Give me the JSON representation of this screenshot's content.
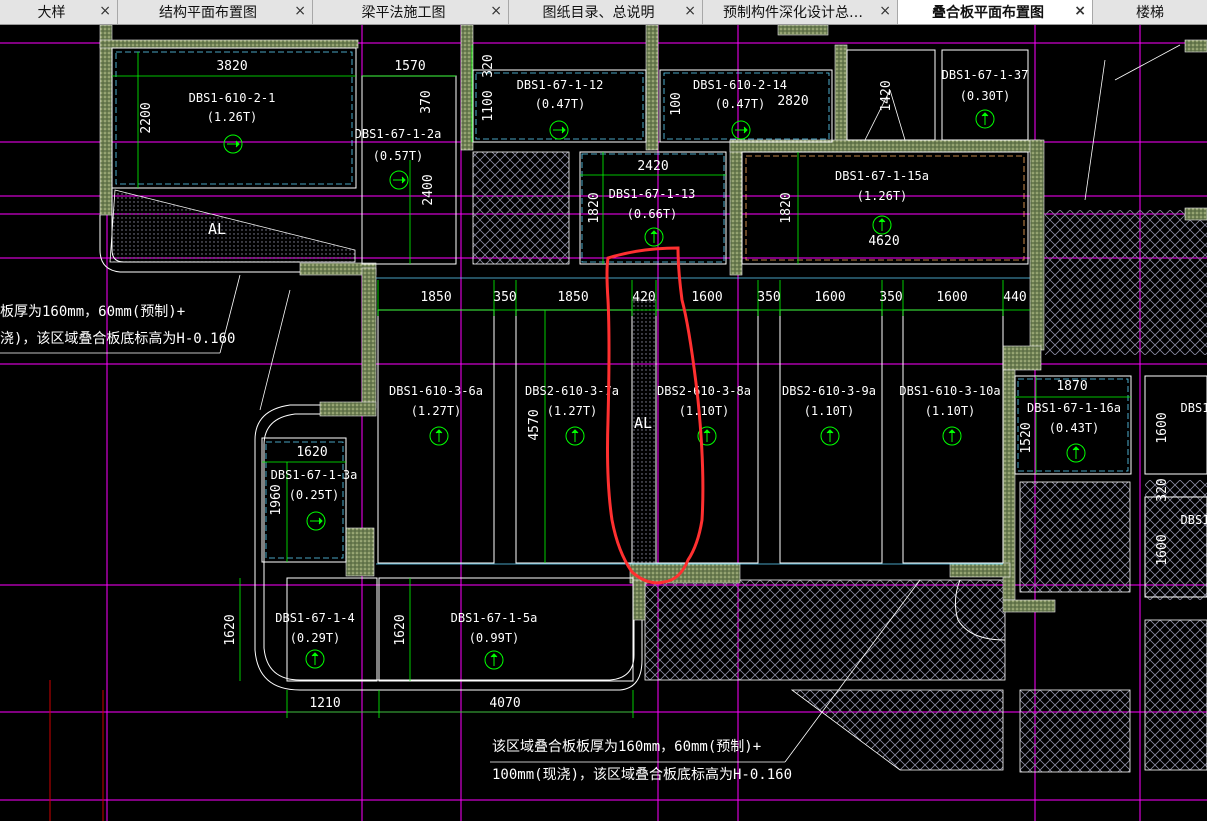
{
  "tabs": [
    {
      "label": "大样",
      "active": false
    },
    {
      "label": "结构平面布置图",
      "active": false
    },
    {
      "label": "梁平法施工图",
      "active": false
    },
    {
      "label": "图纸目录、总说明",
      "active": false
    },
    {
      "label": "预制构件深化设计总…",
      "active": false
    },
    {
      "label": "叠合板平面布置图",
      "active": true
    },
    {
      "label": "楼梯",
      "active": false
    }
  ],
  "close_glyph": "×",
  "colors": {
    "background": "#000000",
    "wall": "#6d7f52",
    "panel_outline": "#ffffff",
    "dimension": "#00ff00",
    "label": "#ffffff",
    "grid_magenta": "#ff00ff",
    "annotation_highlight": "#ff3030",
    "hatch": "#8a8aa0"
  },
  "dimensions": {
    "d3820": "3820",
    "d1570": "1570",
    "d320": "320",
    "d370": "370",
    "d1100": "1100",
    "d100": "100",
    "d2820": "2820",
    "d1420": "1420",
    "d2200": "2200",
    "d2400": "2400",
    "d2420": "2420",
    "d1820a": "1820",
    "d1820b": "1820",
    "d4620": "4620",
    "d1850a": "1850",
    "d350a": "350",
    "d1850b": "1850",
    "d420": "420",
    "d1600a": "1600",
    "d350b": "350",
    "d1600b": "1600",
    "d350c": "350",
    "d1600c": "1600",
    "d440": "440",
    "d1870": "1870",
    "d4570": "4570",
    "d1520": "1520",
    "d1600r1": "1600",
    "d320r": "320",
    "d1600r2": "1600",
    "d1620": "1620",
    "d1960": "1960",
    "d1620b": "1620",
    "d1620c": "1620",
    "d1210": "1210",
    "d4070": "4070"
  },
  "panels": [
    {
      "id": "DBS1-610-2-1",
      "weight": "(1.26T)"
    },
    {
      "id": "DBS1-67-1-2a",
      "weight": "(0.57T)"
    },
    {
      "id": "DBS1-67-1-12",
      "weight": "(0.47T)"
    },
    {
      "id": "DBS1-610-2-14",
      "weight": "(0.47T)"
    },
    {
      "id": "DBS1-67-1-37",
      "weight": "(0.30T)"
    },
    {
      "id": "DBS1-67-1-13",
      "weight": "(0.66T)"
    },
    {
      "id": "DBS1-67-1-15a",
      "weight": "(1.26T)"
    },
    {
      "id": "DBS1-610-3-6a",
      "weight": "(1.27T)"
    },
    {
      "id": "DBS2-610-3-7a",
      "weight": "(1.27T)"
    },
    {
      "id": "DBS2-610-3-8a",
      "weight": "(1.10T)"
    },
    {
      "id": "DBS2-610-3-9a",
      "weight": "(1.10T)"
    },
    {
      "id": "DBS1-610-3-10a",
      "weight": "(1.10T)"
    },
    {
      "id": "DBS1-67-1-16a",
      "weight": "(0.43T)"
    },
    {
      "id": "DBS1-67-1-3a",
      "weight": "(0.25T)"
    },
    {
      "id": "DBS1-67-1-4",
      "weight": "(0.29T)"
    },
    {
      "id": "DBS1-67-1-5a",
      "weight": "(0.99T)"
    }
  ],
  "edge_labels": {
    "dbs1_right_1": "DBS1",
    "dbs1_right_2": "DBS1"
  },
  "al_labels": {
    "al1": "AL",
    "al2": "AL"
  },
  "notes": {
    "left_line1": "板厚为160mm，60mm(预制)+",
    "left_line2": "浇)，该区域叠合板底标高为H-0.160",
    "bottom_line1": "该区域叠合板板厚为160mm，60mm(预制)+",
    "bottom_line2": "100mm(现浇)，该区域叠合板底标高为H-0.160"
  }
}
